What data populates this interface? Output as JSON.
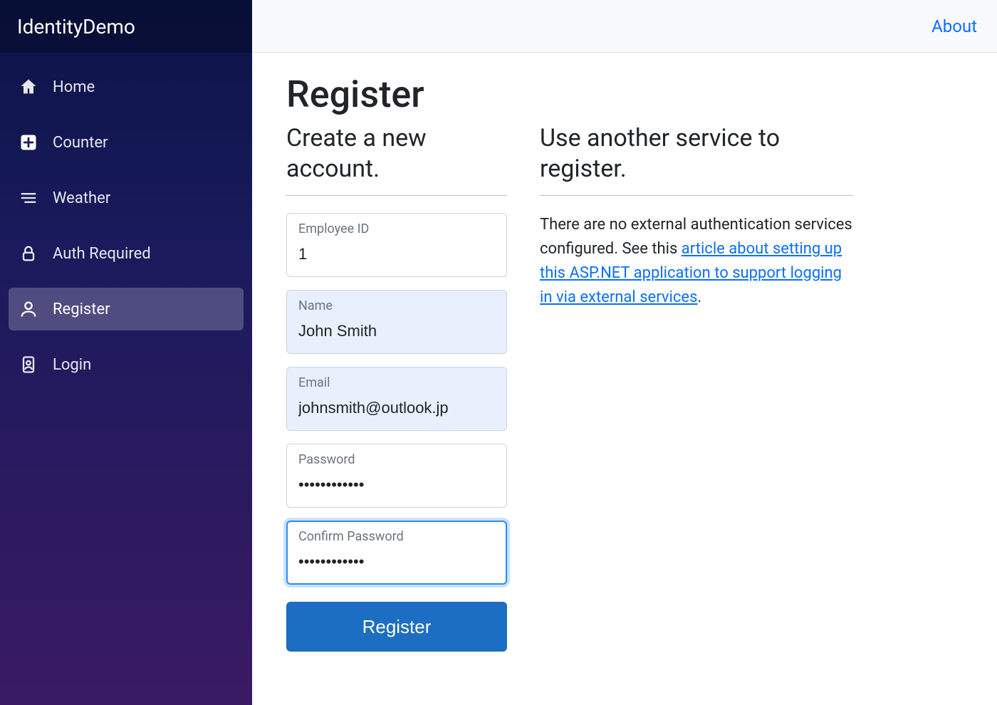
{
  "brand": "IdentityDemo",
  "sidebar": {
    "items": [
      {
        "label": "Home",
        "icon": "home-icon"
      },
      {
        "label": "Counter",
        "icon": "plus-square-icon"
      },
      {
        "label": "Weather",
        "icon": "list-icon"
      },
      {
        "label": "Auth Required",
        "icon": "lock-icon"
      },
      {
        "label": "Register",
        "icon": "person-icon"
      },
      {
        "label": "Login",
        "icon": "id-card-icon"
      }
    ],
    "activeIndex": 4
  },
  "topbar": {
    "about": "About"
  },
  "register": {
    "title": "Register",
    "createHeading": "Create a new account.",
    "fields": {
      "employeeId": {
        "label": "Employee ID",
        "value": "1"
      },
      "name": {
        "label": "Name",
        "value": "John Smith"
      },
      "email": {
        "label": "Email",
        "value": "johnsmith@outlook.jp"
      },
      "password": {
        "label": "Password",
        "value": "••••••••••••"
      },
      "confirm": {
        "label": "Confirm Password",
        "value": "••••••••••••"
      }
    },
    "submit": "Register"
  },
  "external": {
    "heading": "Use another service to register.",
    "textBefore": "There are no external authentication services configured. See this ",
    "linkText": "article about setting up this ASP.NET application to support logging in via external services",
    "textAfter": "."
  }
}
